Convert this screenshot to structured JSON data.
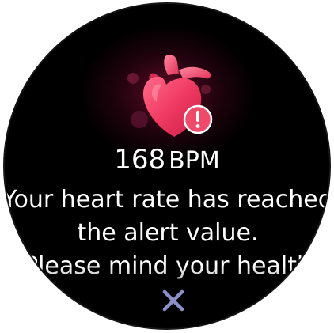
{
  "alert": {
    "bpm_value": "168",
    "bpm_unit": "BPM",
    "message_lines": [
      "Your heart rate has reached",
      "the alert value.",
      "Please mind your health"
    ],
    "close_icon": "close-icon",
    "heart_icon": "heart-alert-icon"
  },
  "colors": {
    "background": "#000000",
    "text": "#ffffff",
    "heart": "#e8325a",
    "close_icon": "#8a90c8"
  }
}
